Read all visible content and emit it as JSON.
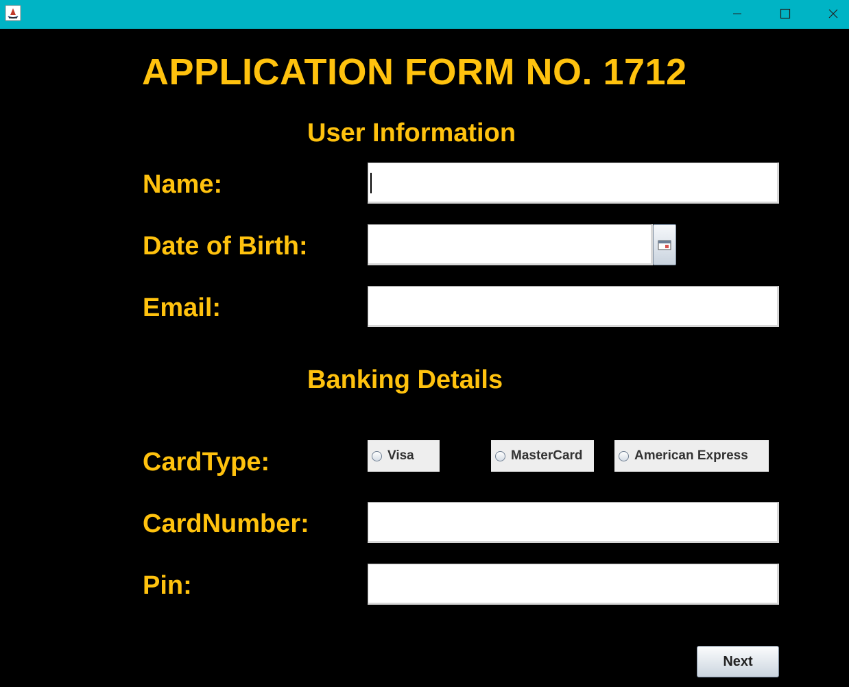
{
  "window": {
    "controls": {
      "minimize": "minimize-icon",
      "maximize": "maximize-icon",
      "close": "close-icon"
    },
    "app_icon": "java-cup-icon"
  },
  "form": {
    "title": "APPLICATION FORM NO. 1712",
    "user_section": "User Information",
    "banking_section": "Banking Details"
  },
  "labels": {
    "name": "Name:",
    "dob": "Date of Birth:",
    "email": "Email:",
    "card_type": "CardType:",
    "card_number": "CardNumber:",
    "pin": "Pin:"
  },
  "fields": {
    "name": "",
    "dob": "",
    "email": "",
    "card_number": "",
    "pin": ""
  },
  "card_types": [
    "Visa",
    "MasterCard",
    "American Express"
  ],
  "buttons": {
    "next": "Next",
    "calendar_icon": "calendar-icon"
  },
  "colors": {
    "titlebar": "#00b4c5",
    "accent": "#ffc20e",
    "background": "#000000"
  }
}
